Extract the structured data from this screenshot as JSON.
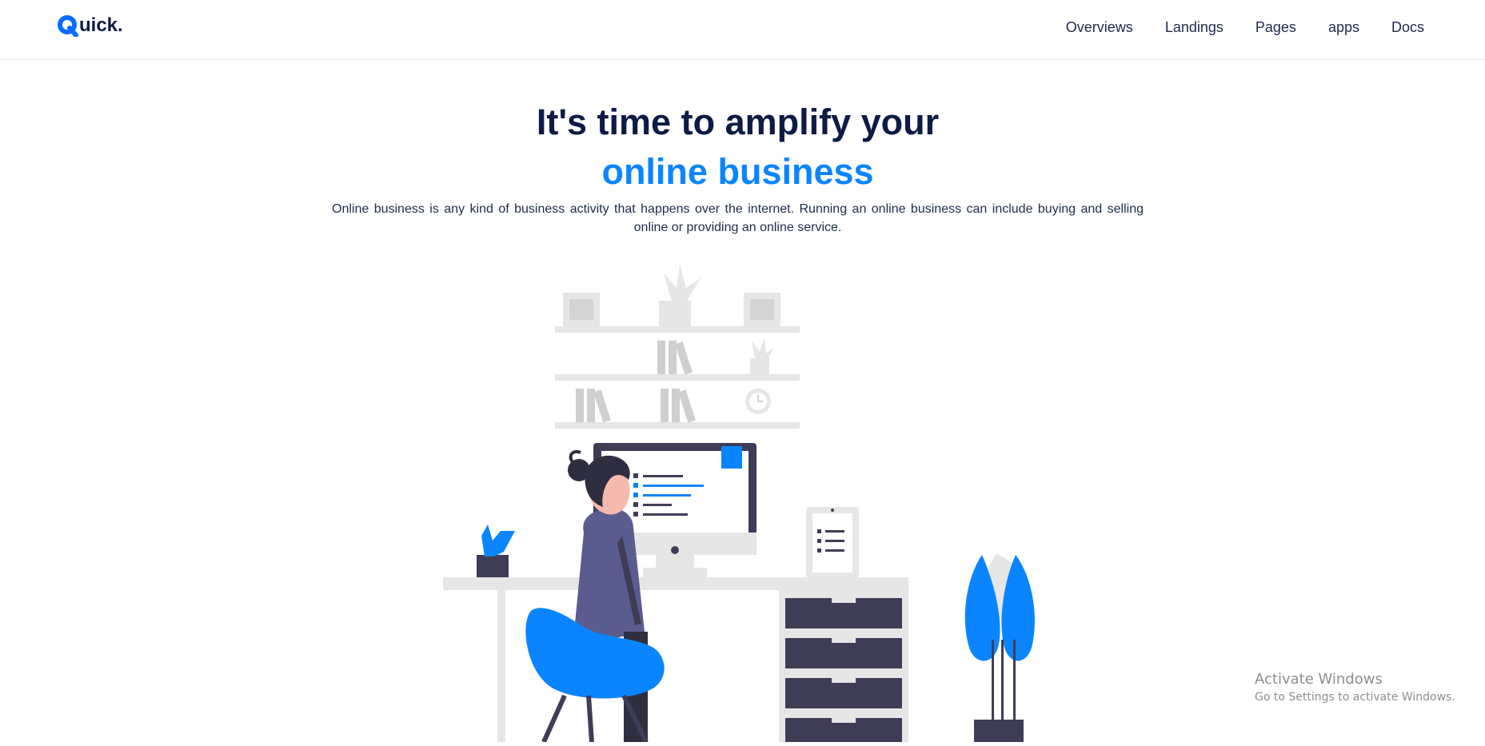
{
  "logo": {
    "letter": "Q",
    "text": "uick",
    "dot": ".",
    "brand_color": "#0a6cff"
  },
  "nav": {
    "items": [
      {
        "label": "Overviews"
      },
      {
        "label": "Landings"
      },
      {
        "label": "Pages"
      },
      {
        "label": "apps"
      },
      {
        "label": "Docs"
      }
    ]
  },
  "hero": {
    "title": "It's time to amplify your",
    "accent": "online business",
    "subtitle": "Online business is any kind of business activity that happens over the internet. Running an online business can include buying and selling online or providing an online service.",
    "title_color": "#0d1b46",
    "accent_color": "#0a85ff"
  },
  "illustration": {
    "icon": "person-at-desk-illustration",
    "accent_color": "#0a85ff",
    "dark_color": "#3f3d56",
    "light_color": "#e6e6e6"
  },
  "watermark": {
    "title": "Activate Windows",
    "subtitle": "Go to Settings to activate Windows."
  }
}
